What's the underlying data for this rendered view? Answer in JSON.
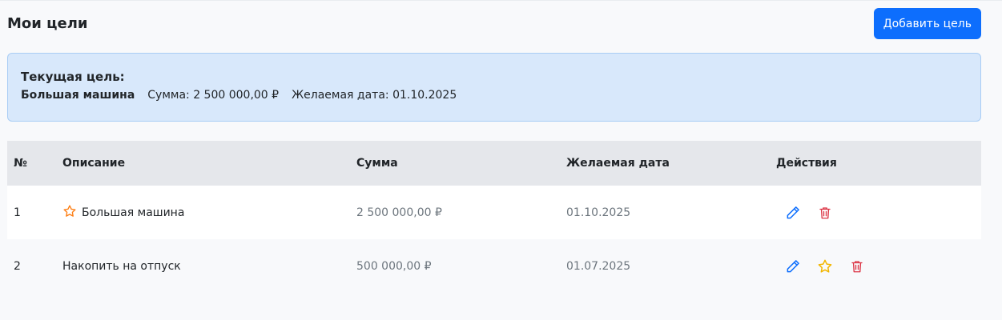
{
  "header": {
    "title": "Мои цели",
    "add_button_label": "Добавить цель"
  },
  "current_goal": {
    "heading": "Текущая цель:",
    "name": "Большая машина",
    "sum_text": "Сумма: 2 500 000,00 ₽",
    "date_text": "Желаемая дата: 01.10.2025"
  },
  "table": {
    "columns": [
      "№",
      "Описание",
      "Сумма",
      "Желаемая дата",
      "Действия"
    ],
    "rows": [
      {
        "num": "1",
        "description": "Большая машина",
        "sum": "2 500 000,00 ₽",
        "date": "01.10.2025",
        "is_current": true
      },
      {
        "num": "2",
        "description": "Накопить на отпуск",
        "sum": "500 000,00 ₽",
        "date": "01.07.2025",
        "is_current": false
      }
    ]
  },
  "icons": {
    "edit": "pencil-icon",
    "make_current": "star-icon",
    "delete": "trash-icon",
    "current_marker": "star-outline-icon"
  },
  "colors": {
    "primary": "#0d6efd",
    "current_star": "#fd7e14",
    "make_current_star": "#f2b600",
    "delete": "#dc3545",
    "panel_bg": "#d8e8fb"
  }
}
